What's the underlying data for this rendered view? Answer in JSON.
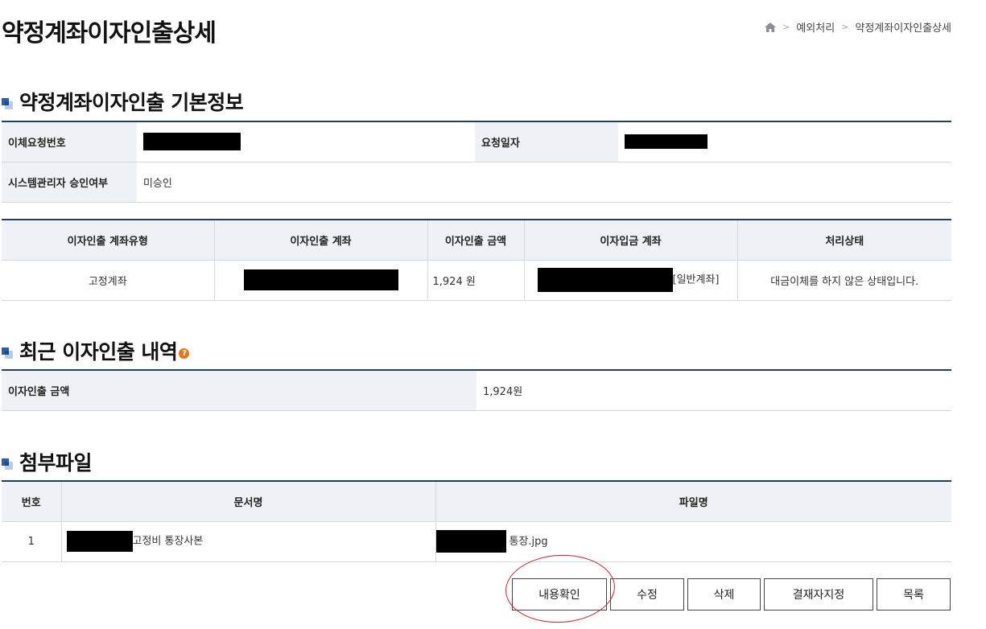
{
  "page": {
    "title": "약정계좌이자인출상세"
  },
  "breadcrumb": {
    "items": [
      "예외처리",
      "약정계좌이자인출상세"
    ]
  },
  "sections": {
    "basic": "약정계좌이자인출 기본정보",
    "recent": "최근 이자인출 내역",
    "attach": "첨부파일"
  },
  "basic_info": {
    "transfer_no_label": "이체요청번호",
    "request_date_label": "요청일자",
    "approval_label": "시스템관리자 승인여부",
    "approval_value": "미승인"
  },
  "account_table": {
    "headers": [
      "이자인출 계좌유형",
      "이자인출 계좌",
      "이자인출 금액",
      "이자입금 계좌",
      "처리상태"
    ],
    "row": {
      "type": "고정계좌",
      "amount": "1,924 원",
      "deposit_suffix": "[일반계좌]",
      "status": "대금이체를 하지 않은 상태입니다."
    }
  },
  "recent": {
    "label": "이자인출 금액",
    "value": "1,924원"
  },
  "attach_table": {
    "headers": [
      "번호",
      "문서명",
      "파일명"
    ],
    "row": {
      "no": "1",
      "doc_suffix": "고정비 통장사본",
      "file_suffix": "통장.jpg"
    }
  },
  "buttons": {
    "confirm": "내용확인",
    "edit": "수정",
    "delete": "삭제",
    "approver": "결재자지정",
    "list": "목록"
  },
  "icons": {
    "home": "home-icon",
    "section": "section-bullet-icon",
    "help": "help-icon"
  },
  "colors": {
    "header_bg": "#eef2f6",
    "top_border": "#1f3f5f",
    "annotation": "#d0202a"
  }
}
